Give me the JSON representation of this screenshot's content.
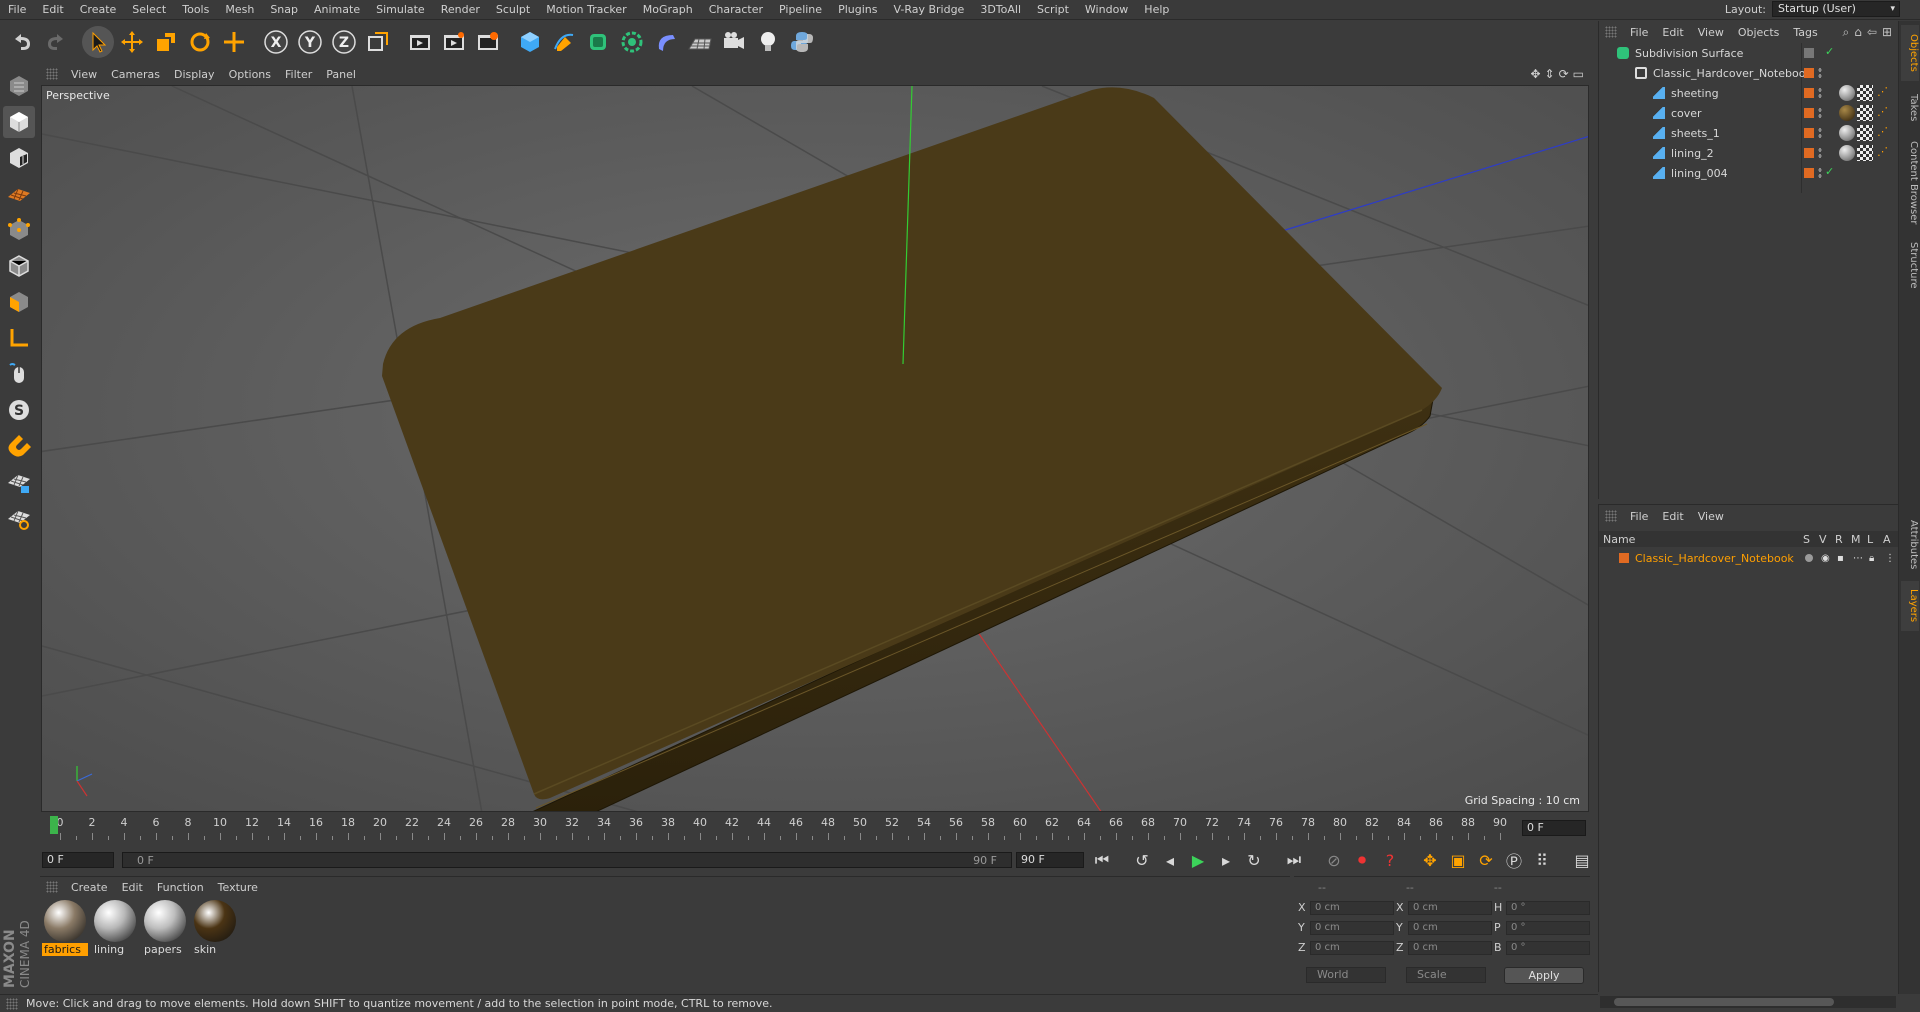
{
  "menubar": {
    "items": [
      "File",
      "Edit",
      "Create",
      "Select",
      "Tools",
      "Mesh",
      "Snap",
      "Animate",
      "Simulate",
      "Render",
      "Sculpt",
      "Motion Tracker",
      "MoGraph",
      "Character",
      "Pipeline",
      "Plugins",
      "V-Ray Bridge",
      "3DToAll",
      "Script",
      "Window",
      "Help"
    ],
    "layout_label": "Layout:",
    "layout_value": "Startup (User)"
  },
  "toolbar": {
    "icons": [
      "undo-icon",
      "redo-icon",
      "select-arrow-icon",
      "move-icon",
      "scale-icon",
      "rotate-icon",
      "live-select-icon",
      "x-axis-icon",
      "y-axis-icon",
      "z-axis-icon",
      "coordinate-system-icon",
      "render-view-icon",
      "render-picture-viewer-icon",
      "render-settings-icon",
      "cube-primitive-icon",
      "pen-spline-icon",
      "subdivision-icon",
      "array-icon",
      "deformer-icon",
      "floor-icon",
      "camera-icon",
      "light-icon",
      "python-icon"
    ]
  },
  "lefttools": {
    "icons": [
      "make-editable-icon",
      "model-mode-icon",
      "texture-mode-icon",
      "workplane-icon",
      "points-mode-icon",
      "edges-mode-icon",
      "polygons-mode-icon",
      "axis-mode-icon",
      "tweak-icon",
      "solo-icon",
      "snap-magnet-icon",
      "grid-lock-icon",
      "workplane-lock-icon"
    ]
  },
  "brand": {
    "line1": "MAXON",
    "line2": "CINEMA 4D"
  },
  "viewport": {
    "menu": [
      "View",
      "Cameras",
      "Display",
      "Options",
      "Filter",
      "Panel"
    ],
    "label": "Perspective",
    "grid_spacing": "Grid Spacing : 10 cm",
    "nav_icons": [
      "move-view-icon",
      "zoom-view-icon",
      "rotate-view-icon",
      "maximize-view-icon"
    ]
  },
  "timeline": {
    "ticks": [
      "0",
      "2",
      "4",
      "6",
      "8",
      "10",
      "12",
      "14",
      "16",
      "18",
      "20",
      "22",
      "24",
      "26",
      "28",
      "30",
      "32",
      "34",
      "36",
      "38",
      "40",
      "42",
      "44",
      "46",
      "48",
      "50",
      "52",
      "54",
      "56",
      "58",
      "60",
      "62",
      "64",
      "66",
      "68",
      "70",
      "72",
      "74",
      "76",
      "78",
      "80",
      "82",
      "84",
      "86",
      "88",
      "90"
    ],
    "current_frame": "0 F"
  },
  "transport": {
    "start_field": "0 F",
    "range_start": "0 F",
    "range_end": "90 F",
    "end_field": "90 F"
  },
  "materials": {
    "menu": [
      "Create",
      "Edit",
      "Function",
      "Texture"
    ],
    "items": [
      {
        "name": "fabrics",
        "color": "#8a7a66",
        "selected": true
      },
      {
        "name": "lining",
        "color": "#b8b8b8",
        "selected": false
      },
      {
        "name": "papers",
        "color": "#bdbdbd",
        "selected": false
      },
      {
        "name": "skin",
        "color": "#4b3414",
        "selected": false
      }
    ]
  },
  "coords": {
    "headers": [
      "--",
      "--",
      "--"
    ],
    "rows": [
      {
        "a1": "X",
        "v1": "0 cm",
        "a2": "X",
        "v2": "0 cm",
        "a3": "H",
        "v3": "0 °"
      },
      {
        "a1": "Y",
        "v1": "0 cm",
        "a2": "Y",
        "v2": "0 cm",
        "a3": "P",
        "v3": "0 °"
      },
      {
        "a1": "Z",
        "v1": "0 cm",
        "a2": "Z",
        "v2": "0 cm",
        "a3": "B",
        "v3": "0 °"
      }
    ],
    "space": "World",
    "mode": "Scale",
    "apply": "Apply"
  },
  "status": {
    "text": "Move: Click and drag to move elements. Hold down SHIFT to quantize movement / add to the selection in point mode, CTRL to remove."
  },
  "objects": {
    "menu": [
      "File",
      "Edit",
      "View",
      "Objects",
      "Tags"
    ],
    "tree": [
      {
        "name": "Subdivision Surface",
        "indent": 0,
        "icon": "subdivision-surface-icon"
      },
      {
        "name": "Classic_Hardcover_Notebook",
        "indent": 1,
        "icon": "null-object-icon"
      },
      {
        "name": "sheeting",
        "indent": 2,
        "icon": "polygon-object-icon"
      },
      {
        "name": "cover",
        "indent": 2,
        "icon": "polygon-object-icon"
      },
      {
        "name": "sheets_1",
        "indent": 2,
        "icon": "polygon-object-icon"
      },
      {
        "name": "lining_2",
        "indent": 2,
        "icon": "polygon-object-icon"
      },
      {
        "name": "lining_004",
        "indent": 2,
        "icon": "polygon-object-icon"
      }
    ]
  },
  "layers": {
    "menu": [
      "File",
      "Edit",
      "View"
    ],
    "columns": [
      "Name",
      "S",
      "V",
      "R",
      "M",
      "L",
      "A"
    ],
    "rows": [
      {
        "name": "Classic_Hardcover_Notebook",
        "color": "#e06a22"
      }
    ]
  },
  "side_tabs": [
    "Objects",
    "Takes",
    "Content Browser",
    "Structure",
    "Attributes",
    "Layers"
  ],
  "colors": {
    "accent": "#ff9f00",
    "layer_swatch": "#e06a22",
    "viewport_bg": "#5a5a5a",
    "notebook": "#4a3a18"
  }
}
